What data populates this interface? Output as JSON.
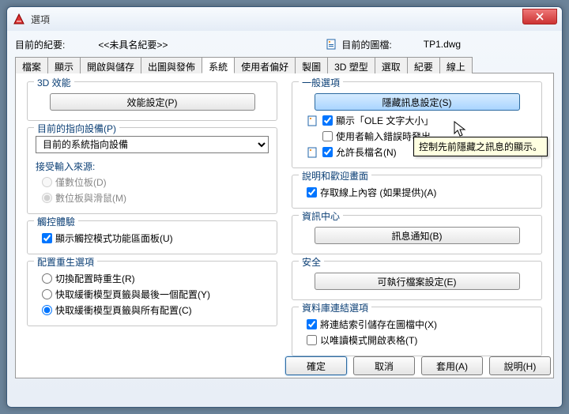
{
  "window": {
    "title": "選項"
  },
  "top": {
    "current_record_label": "目前的紀要:",
    "profile_name": "<<未具名紀要>>",
    "current_drawing_label": "目前的圖檔:",
    "drawing_name": "TP1.dwg"
  },
  "tabs": [
    "檔案",
    "顯示",
    "開啟與儲存",
    "出圖與發佈",
    "系統",
    "使用者偏好",
    "製圖",
    "3D 塑型",
    "選取",
    "紀要",
    "線上"
  ],
  "active_tab_index": 4,
  "left": {
    "g1": {
      "cap": "3D 效能",
      "btn": "效能設定(P)"
    },
    "g2": {
      "cap": "目前的指向設備(P)",
      "select": "目前的系統指向設備",
      "sub_cap": "接受輸入來源:",
      "r1": "僅數位板(D)",
      "r2": "數位板與滑鼠(M)"
    },
    "g3": {
      "cap": "觸控體驗",
      "c1": "顯示觸控模式功能區面板(U)"
    },
    "g4": {
      "cap": "配置重生選項",
      "r1": "切換配置時重生(R)",
      "r2": "快取緩衝模型頁籤與最後一個配置(Y)",
      "r3": "快取緩衝模型頁籤與所有配置(C)"
    }
  },
  "right": {
    "g1": {
      "cap": "一般選項",
      "btn": "隱藏訊息設定(S)",
      "c1": "顯示「OLE 文字大小」",
      "c2": "使用者輸入錯誤時發出",
      "c3": "允許長檔名(N)"
    },
    "g2": {
      "cap": "說明和歡迎畫面",
      "c1": "存取線上內容 (如果提供)(A)"
    },
    "g3": {
      "cap": "資訊中心",
      "btn": "訊息通知(B)"
    },
    "g4": {
      "cap": "安全",
      "btn": "可執行檔案設定(E)"
    },
    "g5": {
      "cap": "資料庫連結選項",
      "c1": "將連結索引儲存在圖檔中(X)",
      "c2": "以唯讀模式開啟表格(T)"
    }
  },
  "tooltip": "控制先前隱藏之訊息的顯示。",
  "footer": {
    "ok": "確定",
    "cancel": "取消",
    "apply": "套用(A)",
    "help": "說明(H)"
  }
}
